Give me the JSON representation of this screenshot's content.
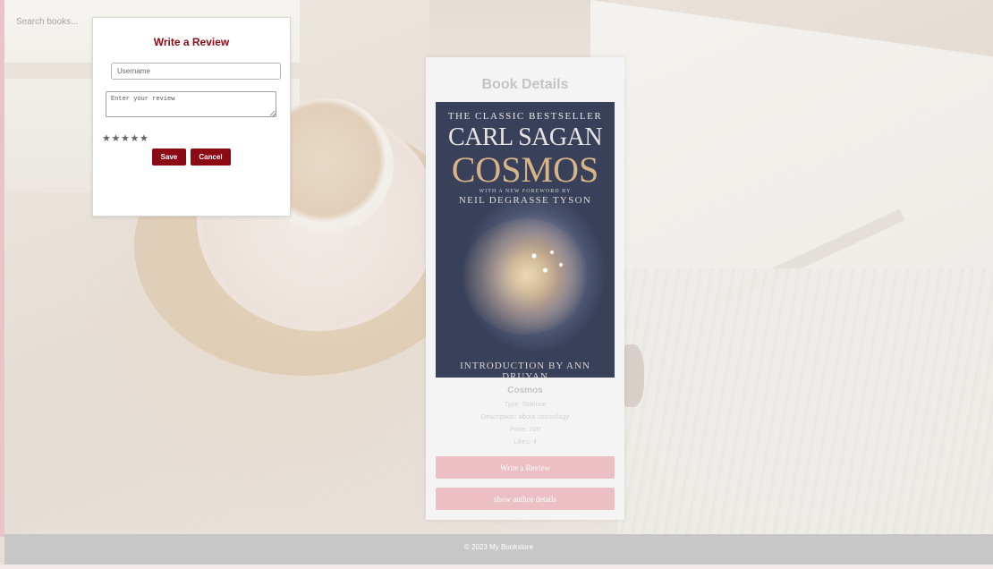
{
  "search": {
    "placeholder": "Search books..."
  },
  "book_details": {
    "title": "Book Details",
    "cover": {
      "tagline": "THE CLASSIC BESTSELLER",
      "author": "CARL SAGAN",
      "title": "COSMOS",
      "foreword_line": "WITH A NEW FOREWORD BY",
      "foreword_author": "NEIL DEGRASSE TYSON",
      "bottom_line": "INTRODUCTION BY ANN DRUYAN"
    },
    "name": "Cosmos",
    "type": "Type: Science",
    "description": "Description: about cosmology",
    "price": "Price: 200",
    "likes": "Likes: 4",
    "write_review_label": "Write a Review",
    "author_details_label": "show author details"
  },
  "review_modal": {
    "title": "Write a Review",
    "username_placeholder": "Username",
    "review_placeholder": "Enter your review",
    "stars": [
      "★",
      "★",
      "★",
      "★",
      "★"
    ],
    "save_label": "Save",
    "cancel_label": "Cancel"
  },
  "footer": {
    "text": "© 2023 My Bookstore"
  },
  "colors": {
    "accent": "#8b0a14",
    "card_button": "#ebbfc3",
    "footer_bg": "#c7c7c7"
  }
}
